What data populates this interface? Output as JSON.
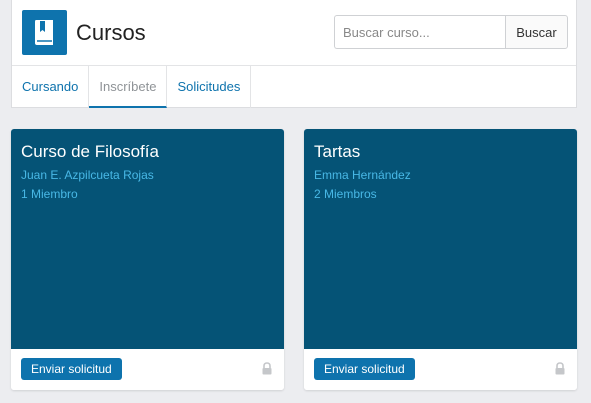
{
  "header": {
    "title": "Cursos",
    "logo_icon": "book-icon",
    "brand_color": "#0e73ad"
  },
  "search": {
    "placeholder": "Buscar curso...",
    "value": "",
    "button_label": "Buscar"
  },
  "tabs": [
    {
      "label": "Cursando",
      "active": false
    },
    {
      "label": "Inscríbete",
      "active": true
    },
    {
      "label": "Solicitudes",
      "active": false
    }
  ],
  "courses": [
    {
      "title": "Curso de Filosofía",
      "owner": "Juan E. Azpilcueta Rojas",
      "members": "1 Miembro",
      "action_label": "Enviar solicitud",
      "status_icon": "lock-icon"
    },
    {
      "title": "Tartas",
      "owner": "Emma Hernández",
      "members": "2 Miembros",
      "action_label": "Enviar solicitud",
      "status_icon": "lock-icon"
    }
  ],
  "colors": {
    "card_banner": "#055376",
    "card_subtext": "#48b8e6",
    "page_background": "#ecedf0"
  }
}
